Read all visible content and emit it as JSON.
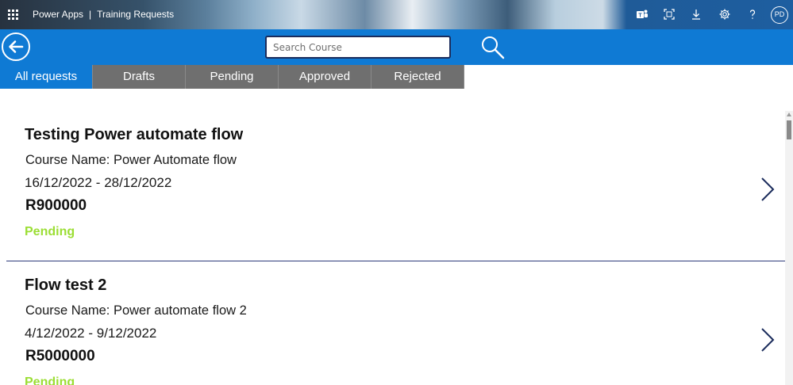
{
  "suite": {
    "app_name": "Power Apps",
    "separator": "|",
    "app_title": "Training Requests",
    "icons": [
      "waffle-icon",
      "teams-icon",
      "fit-screen-icon",
      "download-icon",
      "settings-icon",
      "help-icon"
    ],
    "avatar_initials": "PD"
  },
  "header": {
    "search_placeholder": "Search Course",
    "accent": "#0f7ad4"
  },
  "tabs": [
    {
      "label": "All requests",
      "active": true
    },
    {
      "label": "Drafts",
      "active": false
    },
    {
      "label": "Pending",
      "active": false
    },
    {
      "label": "Approved",
      "active": false
    },
    {
      "label": "Rejected",
      "active": false
    }
  ],
  "requests": [
    {
      "title": "Testing Power automate flow",
      "course": "Course Name: Power Automate flow",
      "dates": "16/12/2022  -  28/12/2022",
      "amount": "R900000",
      "status": "Pending"
    },
    {
      "title": "Flow test 2",
      "course": "Course Name: Power automate flow 2",
      "dates": "4/12/2022  -  9/12/2022",
      "amount": "R5000000",
      "status": "Pending"
    }
  ],
  "colors": {
    "status_pending": "#9bde34",
    "tab_inactive": "#6f6f6f",
    "divider": "#2c3a7a",
    "chevron": "#1b2c5c"
  }
}
